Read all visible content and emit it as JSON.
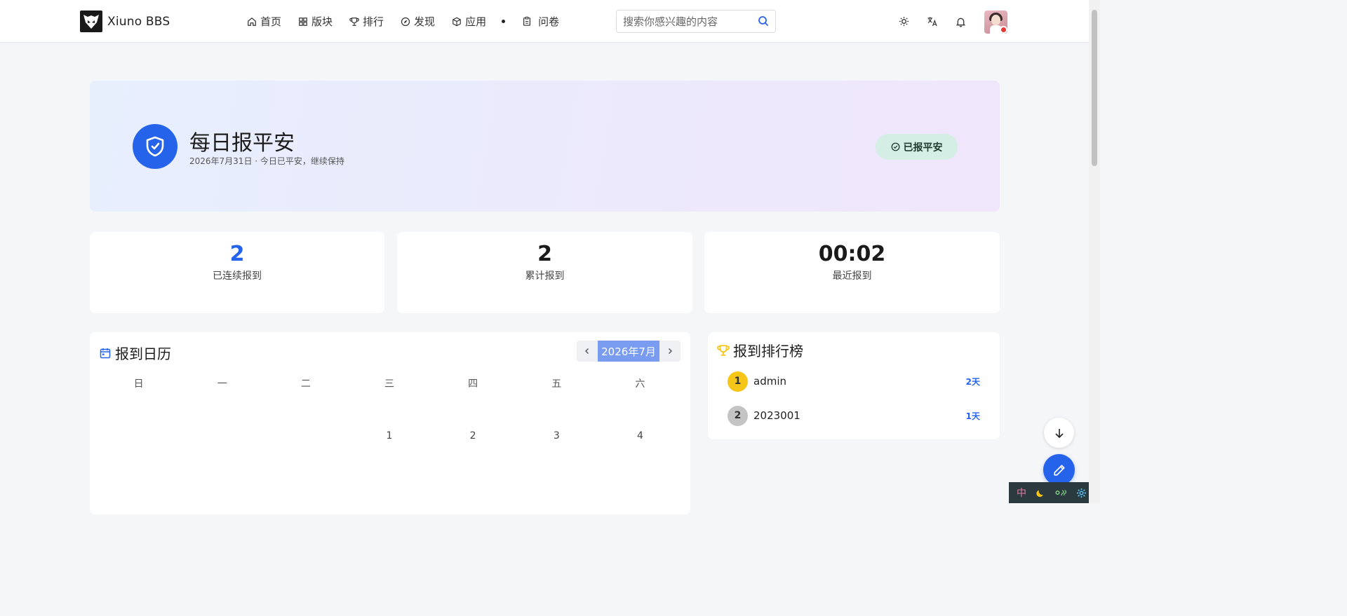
{
  "header": {
    "logo_text": "Xiuno BBS",
    "nav": [
      {
        "label": "首页",
        "icon": "home-icon"
      },
      {
        "label": "版块",
        "icon": "grid-icon"
      },
      {
        "label": "排行",
        "icon": "trophy-icon"
      },
      {
        "label": "发现",
        "icon": "compass-icon"
      },
      {
        "label": "应用",
        "icon": "box-icon"
      },
      {
        "label": "问卷",
        "icon": "clipboard-icon"
      }
    ],
    "search_placeholder": "搜索你感兴趣的内容",
    "icons": [
      "sun-icon",
      "translate-icon",
      "bell-icon"
    ]
  },
  "hero": {
    "title": "每日报平安",
    "subtitle": "2026年7月31日 · 今日已平安，继续保持",
    "badge": "已报平安"
  },
  "stats": [
    {
      "value": "2",
      "label": "已连续报到"
    },
    {
      "value": "2",
      "label": "累计报到"
    },
    {
      "value": "00:02",
      "label": "最近报到"
    }
  ],
  "calendar": {
    "title": "报到日历",
    "month": "2026年7月",
    "weekdays": [
      "日",
      "一",
      "二",
      "三",
      "四",
      "五",
      "六"
    ],
    "first_row": [
      "",
      "",
      "",
      "1",
      "2",
      "3",
      "4"
    ]
  },
  "ranking": {
    "title": "报到排行榜",
    "items": [
      {
        "rank": "1",
        "name": "admin",
        "days": "2天"
      },
      {
        "rank": "2",
        "name": "2023001",
        "days": "1天"
      }
    ]
  },
  "ime": {
    "lang": "中"
  },
  "colors": {
    "accent": "#2563eb",
    "gold": "#f5c518",
    "silver": "#c4c4c4"
  }
}
